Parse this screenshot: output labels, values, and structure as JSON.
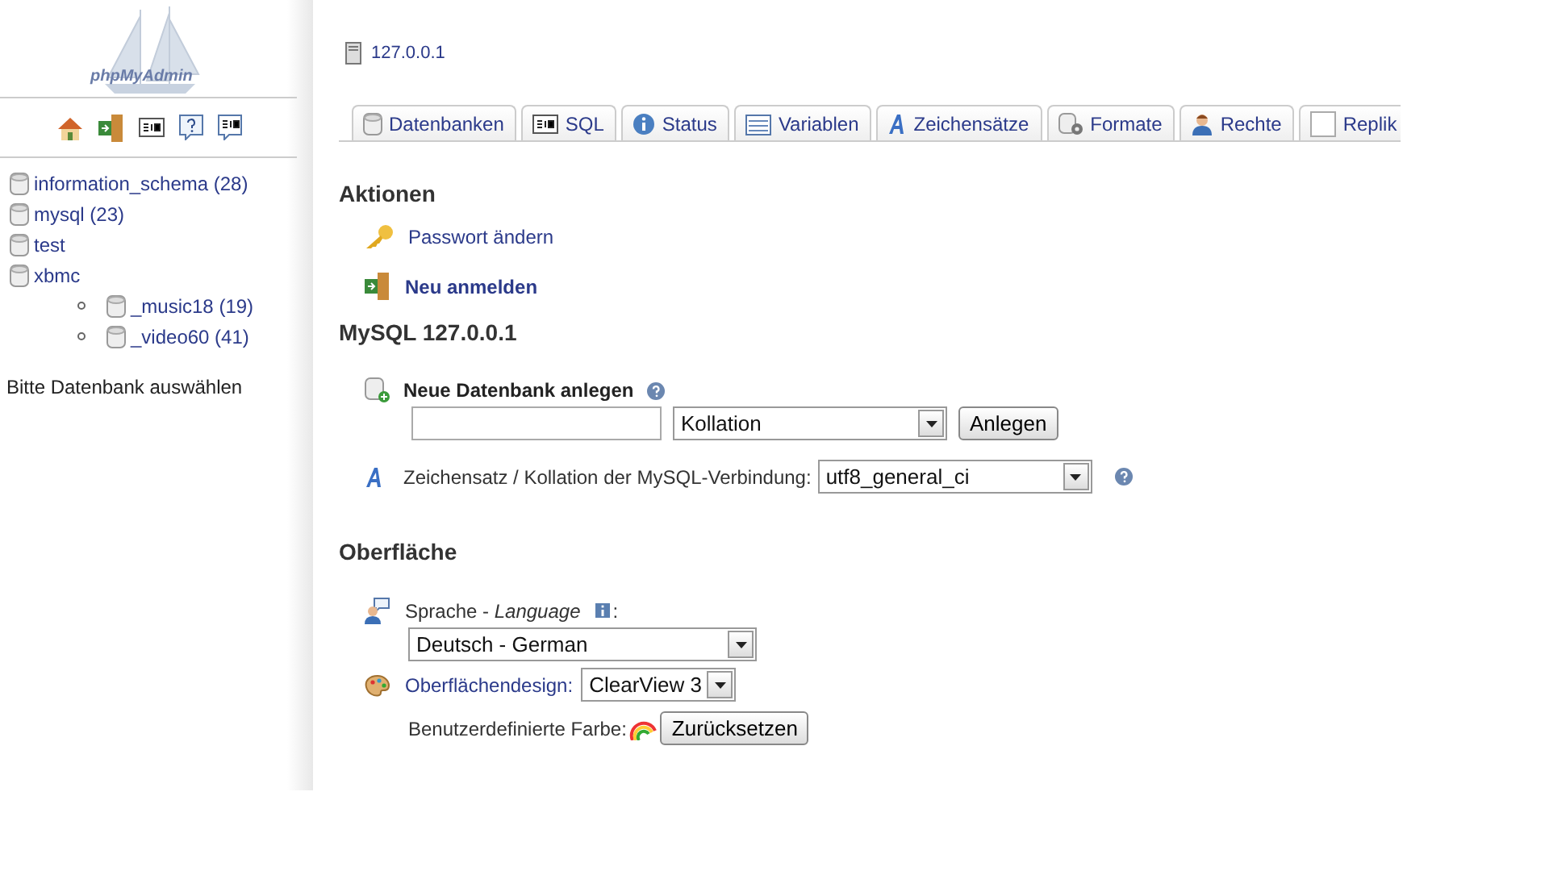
{
  "sidebar": {
    "logo": "phpMyAdmin",
    "toolbar": [
      {
        "kind": "home"
      },
      {
        "kind": "exit"
      },
      {
        "kind": "sql"
      },
      {
        "kind": "help"
      },
      {
        "kind": "sqlquery"
      }
    ],
    "databases": [
      {
        "name": "information_schema (28)"
      },
      {
        "name": "mysql (23)"
      },
      {
        "name": "test"
      },
      {
        "name": "xbmc",
        "children": [
          {
            "name": "_music18 (19)"
          },
          {
            "name": "_video60 (41)"
          }
        ]
      }
    ],
    "hint": "Bitte Datenbank auswählen"
  },
  "server": "127.0.0.1",
  "tabs": [
    {
      "label": "Datenbanken",
      "kind": "db"
    },
    {
      "label": "SQL",
      "kind": "sql"
    },
    {
      "label": "Status",
      "kind": "info"
    },
    {
      "label": "Variablen",
      "kind": "list"
    },
    {
      "label": "Zeichensätze",
      "kind": "font"
    },
    {
      "label": "Formate",
      "kind": "engine"
    },
    {
      "label": "Rechte",
      "kind": "user"
    },
    {
      "label": "Replik",
      "kind": "blank"
    }
  ],
  "actions": {
    "title": "Aktionen",
    "items": [
      {
        "label": "Passwort ändern",
        "kind": "key",
        "bold": false
      },
      {
        "label": "Neu anmelden",
        "kind": "exit",
        "bold": true
      }
    ]
  },
  "mysql": {
    "title": "MySQL 127.0.0.1",
    "new_db": {
      "label": "Neue Datenbank anlegen",
      "collation": "Kollation",
      "button": "Anlegen"
    },
    "connection": {
      "label": "Zeichensatz / Kollation der MySQL-Verbindung:",
      "value": "utf8_general_ci"
    }
  },
  "interface": {
    "title": "Oberfläche",
    "language": {
      "label": "Sprache - *Language*",
      "colon": ":",
      "value": "Deutsch - German"
    },
    "theme": {
      "label": "Oberflächendesign:",
      "value": "ClearView 3"
    },
    "color": {
      "label": "Benutzerdefinierte Farbe:",
      "button": "Zurücksetzen"
    }
  }
}
